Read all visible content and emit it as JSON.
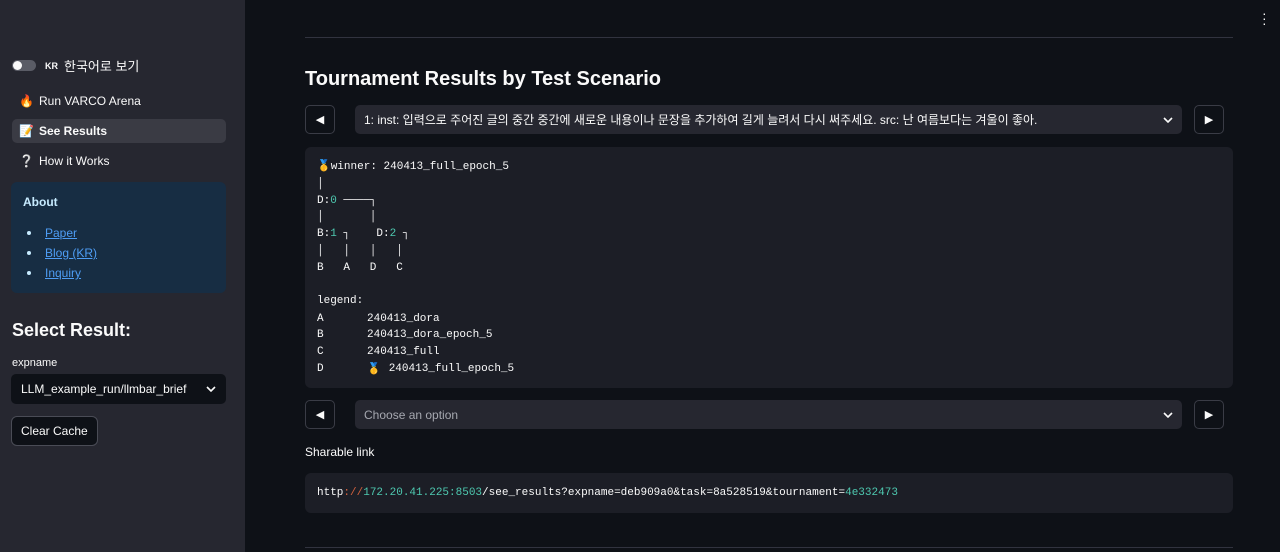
{
  "sidebar": {
    "toggle": {
      "tag": "KR",
      "label": "한국어로 보기"
    },
    "nav": [
      {
        "icon": "🔥",
        "label": "Run VARCO Arena",
        "active": false
      },
      {
        "icon": "📝",
        "label": "See Results",
        "active": true
      },
      {
        "icon": "❔",
        "label": "How it Works",
        "active": false
      }
    ],
    "about": {
      "title": "About",
      "links": [
        "Paper",
        "Blog (KR)",
        "Inquiry"
      ]
    },
    "select_title": "Select Result:",
    "expname_label": "expname",
    "expname_value": "LLM_example_run/llmbar_brief",
    "clear_cache": "Clear Cache"
  },
  "main": {
    "title": "Tournament Results by Test Scenario",
    "prev_glyph": "◀",
    "next_glyph": "▶",
    "scenario_select": "1: inst: 입력으로 주어진 글의 중간 중간에 새로운 내용이나 문장을 추가하여 길게 늘려서 다시 써주세요. src: 난 여름보다는 겨울이 좋아.",
    "tree": {
      "winner_icon": "🥇",
      "winner_label": "winner",
      "winner_value": "240413_full_epoch_5",
      "line_pipe1": "│",
      "d_prefix": "D:",
      "d_num": "0",
      "d_branch": " ────┐",
      "line_pipes2": "│       │",
      "b_prefix": "B:",
      "b_num": "1",
      "b_mid": " ┐    D:",
      "d2_num": "2",
      "d2_tail": " ┐",
      "line_pipes3": "│   │   │   │",
      "line_leaves": "B   A   D   C",
      "legend_title": "legend",
      "legend": [
        {
          "key": "A",
          "value": "240413_dora",
          "icon": ""
        },
        {
          "key": "B",
          "value": "240413_dora_epoch_5",
          "icon": ""
        },
        {
          "key": "C",
          "value": "240413_full",
          "icon": ""
        },
        {
          "key": "D",
          "value": "240413_full_epoch_5",
          "icon": "🥇"
        }
      ]
    },
    "second_select_placeholder": "Choose an option",
    "sharable_label": "Sharable link",
    "url": {
      "proto": "http",
      "sep": "://",
      "host": "172.20.41.225:8503",
      "path": "/see_results?expname=deb909a0&task=8a528519&tournament=",
      "tail": "4e332473"
    }
  }
}
